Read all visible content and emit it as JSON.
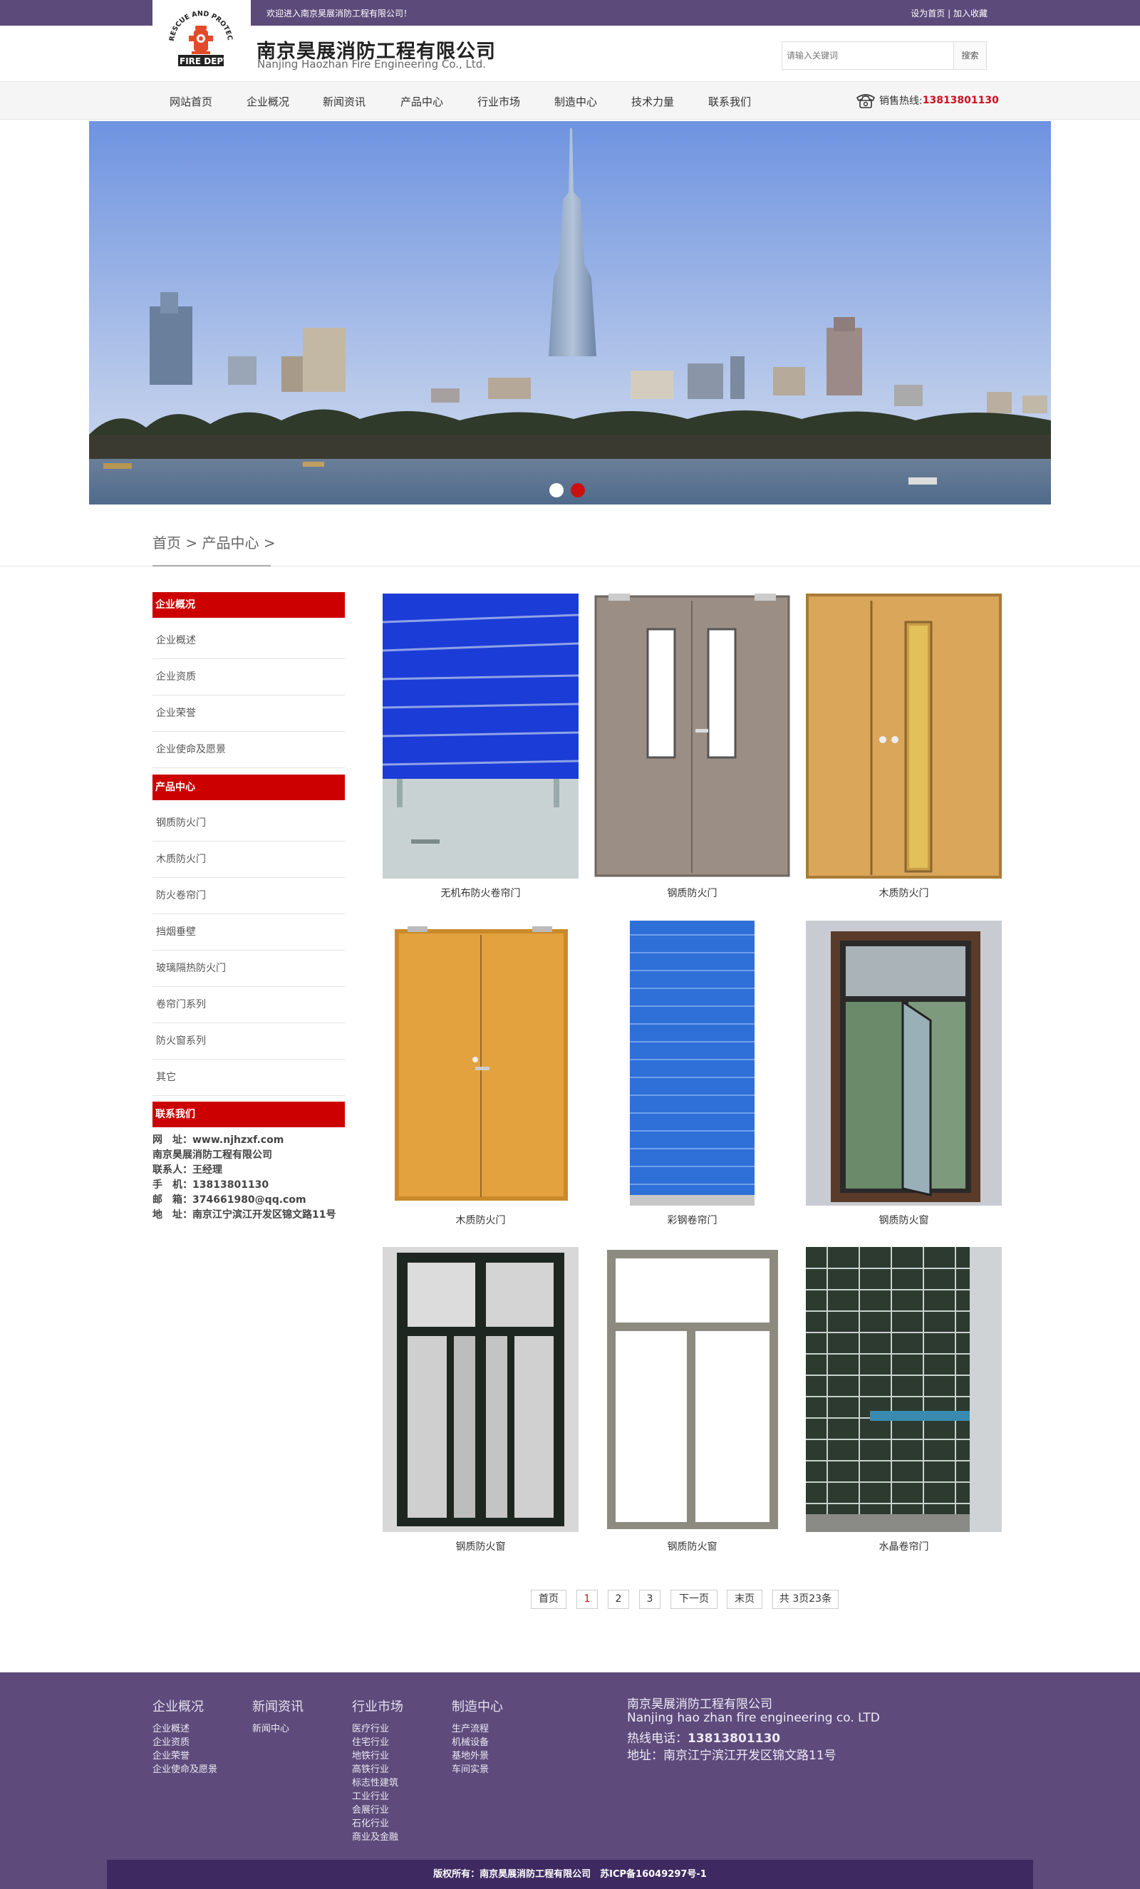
{
  "topbar": {
    "welcome": "欢迎进入南京昊展消防工程有限公司！",
    "set_home": "设为首页",
    "separator": "|",
    "favorite": "加入收藏"
  },
  "header": {
    "logo_text_top": "RESCUE AND PROTECTION",
    "logo_text_bottom": "FIRE DEPT",
    "company_cn": "南京昊展消防工程有限公司",
    "company_en": "Nanjing Haozhan Fire Engineering Co., Ltd.",
    "search_placeholder": "请输入关键词",
    "search_button": "搜索"
  },
  "nav": {
    "items": [
      "网站首页",
      "企业概况",
      "新闻资讯",
      "产品中心",
      "行业市场",
      "制造中心",
      "技术力量",
      "联系我们"
    ],
    "hotline_label": "销售热线:",
    "hotline_number": "13813801130"
  },
  "banner": {
    "active_slide": 2,
    "slide_count": 2,
    "colors": {
      "dot_inactive": "#ffffff",
      "dot_active": "#cc1010"
    }
  },
  "breadcrumb": "首页 > 产品中心 >",
  "sidebar": {
    "company_heading": "企业概况",
    "company_items": [
      "企业概述",
      "企业资质",
      "企业荣誉",
      "企业使命及愿景"
    ],
    "product_heading": "产品中心",
    "product_items": [
      "钢质防火门",
      "木质防火门",
      "防火卷帘门",
      "挡烟垂壁",
      "玻璃隔热防火门",
      "卷帘门系列",
      "防火窗系列",
      "其它"
    ],
    "contact_heading": "联系我们",
    "contact_lines": [
      "网　址：www.njhzxf.com",
      "南京昊展消防工程有限公司",
      "联系人：王经理",
      "手　机：13813801130",
      "邮　箱：374661980@qq.com",
      "地　址：南京江宁滨江开发区锦文路11号"
    ]
  },
  "products": [
    {
      "name": "无机布防火卷帘门",
      "image": "blue-fabric-rolling-shutter"
    },
    {
      "name": "钢质防火门",
      "image": "grey-steel-double-door"
    },
    {
      "name": "木质防火门",
      "image": "wood-double-door-with-window"
    },
    {
      "name": "木质防火门",
      "image": "wood-double-door"
    },
    {
      "name": "彩钢卷帘门",
      "image": "blue-steel-rolling-shutter"
    },
    {
      "name": "钢质防火窗",
      "image": "opening-fire-window"
    },
    {
      "name": "钢质防火窗",
      "image": "dark-frame-window"
    },
    {
      "name": "钢质防火窗",
      "image": "grey-frame-window"
    },
    {
      "name": "水晶卷帘门",
      "image": "crystal-rolling-shutter"
    }
  ],
  "pagination": {
    "first": "首页",
    "pages": [
      "1",
      "2",
      "3"
    ],
    "current": "1",
    "next": "下一页",
    "last": "末页",
    "summary": "共 3页23条"
  },
  "footer": {
    "columns": [
      {
        "title": "企业概况",
        "links": [
          "企业概述",
          "企业资质",
          "企业荣誉",
          "企业使命及愿景"
        ]
      },
      {
        "title": "新闻资讯",
        "links": [
          "新闻中心"
        ]
      },
      {
        "title": "行业市场",
        "links": [
          "医疗行业",
          "住宅行业",
          "地铁行业",
          "高铁行业",
          "标志性建筑",
          "工业行业",
          "会展行业",
          "石化行业",
          "商业及金融"
        ]
      },
      {
        "title": "制造中心",
        "links": [
          "生产流程",
          "机械设备",
          "基地外景",
          "车间实景"
        ]
      }
    ],
    "info_name_cn": "南京昊展消防工程有限公司",
    "info_name_en": "Nanjing hao zhan fire engineering co. LTD",
    "info_hotline_label": "热线电话：",
    "info_hotline": "13813801130",
    "info_address": "地址：南京江宁滨江开发区锦文路11号",
    "copyright": "版权所有：南京昊展消防工程有限公司　苏ICP备16049297号-1"
  },
  "colors": {
    "brand_purple": "#5c4a7a",
    "accent_red": "#cc0000",
    "hotline_red": "#cc1022",
    "copyright_bar": "#3e2a60"
  }
}
